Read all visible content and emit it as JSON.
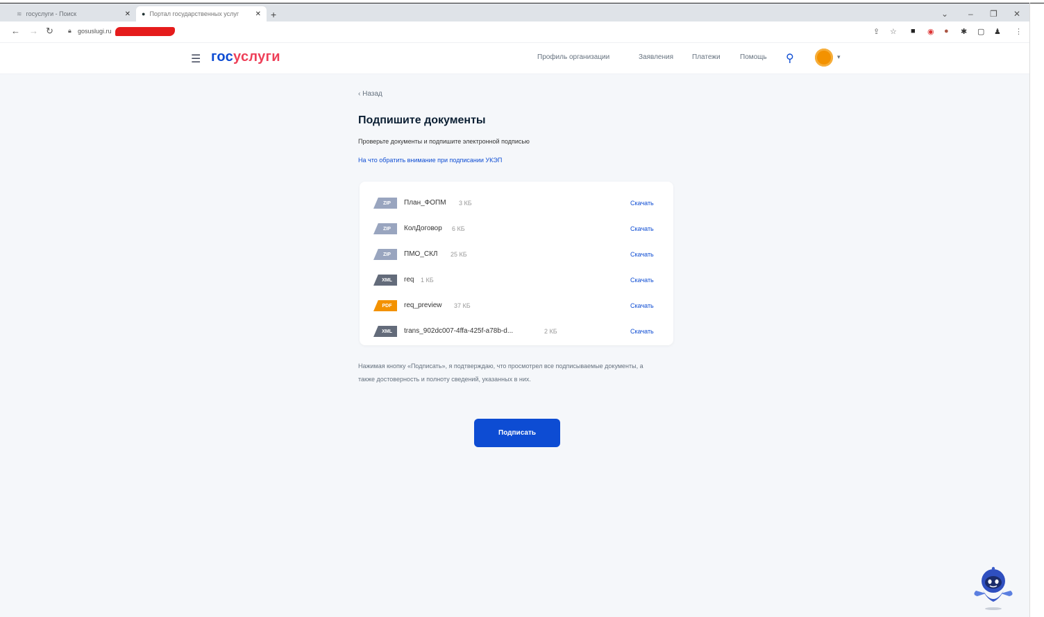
{
  "browser": {
    "tabs": [
      {
        "title": "госуслуги - Поиск",
        "close": "✕"
      },
      {
        "title": "Портал государственных услуг",
        "close": "✕"
      }
    ],
    "new_tab": "+",
    "url": "gosuslugi.ru",
    "window_controls": [
      "⌄",
      "–",
      "❐",
      "✕"
    ]
  },
  "header": {
    "logo_part1": "гос",
    "logo_part2": "услуги",
    "nav": [
      "Профиль организации",
      "Заявления",
      "Платежи",
      "Помощь"
    ]
  },
  "main": {
    "back": "‹ Назад",
    "title": "Подпишите документы",
    "subtitle": "Проверьте документы и подпишите электронной подписью",
    "info_link": "На что обратить внимание при подписании УКЭП",
    "files": [
      {
        "type": "ZIP",
        "name": "План_ФОПМ",
        "size": "3 КБ",
        "action": "Скачать"
      },
      {
        "type": "ZIP",
        "name": "КолДоговор",
        "size": "6 КБ",
        "action": "Скачать"
      },
      {
        "type": "ZIP",
        "name": "ПМО_СКЛ",
        "size": "25 КБ",
        "action": "Скачать"
      },
      {
        "type": "XML",
        "name": "req",
        "size": "1 КБ",
        "action": "Скачать"
      },
      {
        "type": "PDF",
        "name": "req_preview",
        "size": "37 КБ",
        "action": "Скачать"
      },
      {
        "type": "XML",
        "name": "trans_902dc007-4ffa-425f-a78b-d...",
        "size": "2 КБ",
        "action": "Скачать"
      }
    ],
    "note": "Нажимая кнопку «Подписать», я подтверждаю, что просмотрел все подписываемые документы, а также достоверность и полноту сведений, указанных в них.",
    "sign_button": "Подписать"
  },
  "colors": {
    "brand_blue": "#0d4cd3",
    "brand_red": "#ee3f58",
    "accent_orange": "#f39200"
  }
}
